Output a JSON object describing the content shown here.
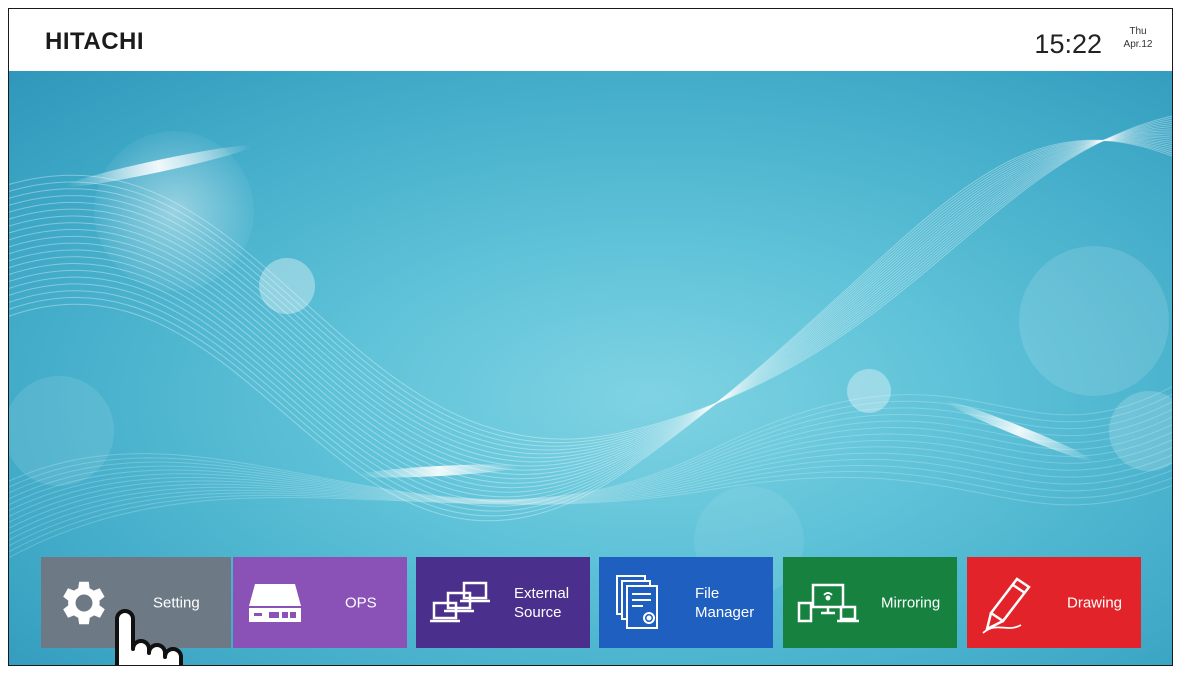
{
  "header": {
    "brand": "HITACHI",
    "time": "15:22",
    "day": "Thu",
    "date": "Apr.12"
  },
  "apps": [
    {
      "label": "Setting",
      "icon": "gear-icon",
      "color": "#6d7a86"
    },
    {
      "label": "OPS",
      "icon": "ops-device-icon",
      "color": "#8a52b6"
    },
    {
      "label_line1": "External",
      "label_line2": "Source",
      "icon": "external-source-icon",
      "color": "#4a2f8c"
    },
    {
      "label_line1": "File",
      "label_line2": "Manager",
      "icon": "file-manager-icon",
      "color": "#1f5fbf"
    },
    {
      "label": "Mirroring",
      "icon": "mirroring-icon",
      "color": "#17823f"
    },
    {
      "label": "Drawing",
      "icon": "pen-icon",
      "color": "#e2242a"
    }
  ],
  "pointer": {
    "icon": "hand-pointer-icon"
  },
  "colors": {
    "wallpaper": "#5ec2d8",
    "header_bg": "#ffffff"
  }
}
